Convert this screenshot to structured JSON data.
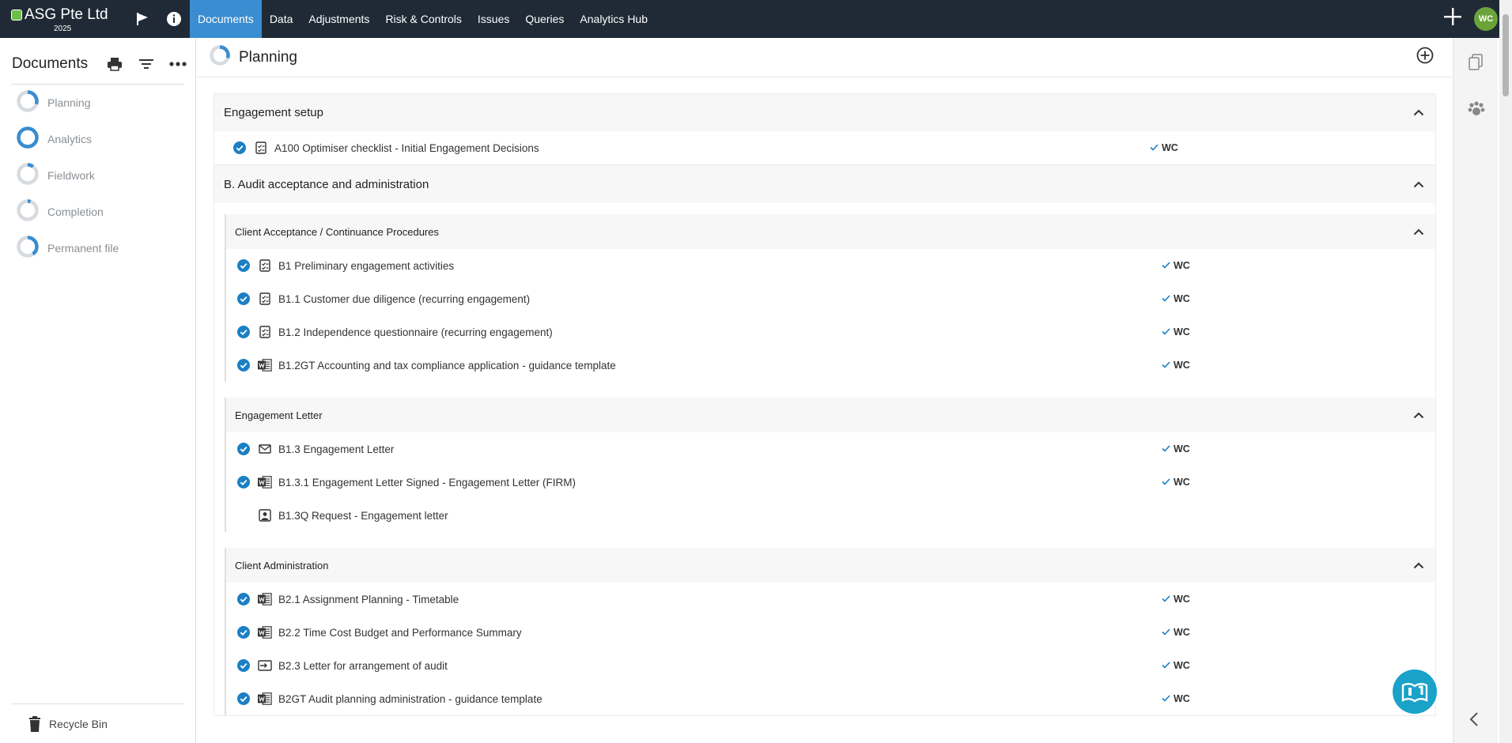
{
  "topbar": {
    "brand_name": "ASG Pte Ltd",
    "brand_year": "2025",
    "nav": [
      {
        "label": "Documents",
        "active": true
      },
      {
        "label": "Data"
      },
      {
        "label": "Adjustments"
      },
      {
        "label": "Risk & Controls"
      },
      {
        "label": "Issues"
      },
      {
        "label": "Queries"
      },
      {
        "label": "Analytics Hub"
      }
    ],
    "avatar_initials": "WC"
  },
  "sidebar": {
    "title": "Documents",
    "items": [
      {
        "label": "Planning",
        "progress": 0.3
      },
      {
        "label": "Analytics",
        "progress": 1.0
      },
      {
        "label": "Fieldwork",
        "progress": 0.1
      },
      {
        "label": "Completion",
        "progress": 0.05
      },
      {
        "label": "Permanent file",
        "progress": 0.4
      }
    ],
    "footer_label": "Recycle Bin"
  },
  "main": {
    "title": "Planning",
    "title_progress": 0.3,
    "sections": [
      {
        "title": "Engagement setup",
        "rows": [
          {
            "label": "A100 Optimiser checklist - Initial Engagement Decisions",
            "icon": "checklist-icon",
            "checked": true,
            "signoff": "WC"
          }
        ]
      },
      {
        "title": "B. Audit acceptance and administration",
        "groups": [
          {
            "title": "Client Acceptance / Continuance Procedures",
            "rows": [
              {
                "label": "B1 Preliminary engagement activities",
                "icon": "checklist-icon",
                "checked": true,
                "signoff": "WC"
              },
              {
                "label": "B1.1 Customer due diligence (recurring engagement)",
                "icon": "checklist-icon",
                "checked": true,
                "signoff": "WC"
              },
              {
                "label": "B1.2 Independence questionnaire (recurring engagement)",
                "icon": "checklist-icon",
                "checked": true,
                "signoff": "WC"
              },
              {
                "label": "B1.2GT Accounting and tax compliance application - guidance template",
                "icon": "word-doc-icon",
                "checked": true,
                "signoff": "WC"
              }
            ]
          },
          {
            "title": "Engagement Letter",
            "rows": [
              {
                "label": "B1.3 Engagement Letter",
                "icon": "envelope-icon",
                "checked": true,
                "signoff": "WC"
              },
              {
                "label": "B1.3.1 Engagement Letter Signed - Engagement Letter (FIRM)",
                "icon": "word-doc-icon",
                "checked": true,
                "signoff": "WC"
              },
              {
                "label": "B1.3Q Request - Engagement letter",
                "icon": "request-icon",
                "checked": false,
                "signoff": ""
              }
            ]
          },
          {
            "title": "Client Administration",
            "rows": [
              {
                "label": "B2.1 Assignment Planning - Timetable",
                "icon": "word-doc-icon",
                "checked": true,
                "signoff": "WC"
              },
              {
                "label": "B2.2 Time Cost Budget and Performance Summary",
                "icon": "word-doc-icon",
                "checked": true,
                "signoff": "WC"
              },
              {
                "label": "B2.3 Letter for arrangement of audit",
                "icon": "letter-icon",
                "checked": true,
                "signoff": "WC"
              },
              {
                "label": "B2GT Audit planning administration - guidance template",
                "icon": "word-doc-icon",
                "checked": true,
                "signoff": "WC"
              }
            ]
          }
        ]
      }
    ]
  },
  "colors": {
    "topbar": "#1f2a36",
    "accent": "#3a8dd0",
    "check": "#1b7fc4",
    "avatar": "#6ba33a",
    "help_fab": "#1aa2c8"
  }
}
